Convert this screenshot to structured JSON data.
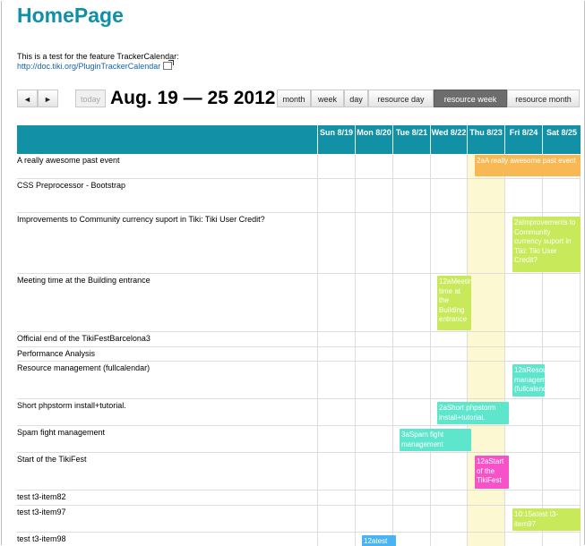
{
  "page": {
    "title": "HomePage",
    "description": "This is a test for the feature TrackerCalendar:",
    "link": "http://doc.tiki.org/PluginTrackerCalendar"
  },
  "toolbar": {
    "prev": "◄",
    "next": "►",
    "today": "today",
    "range": "Aug. 19 — 25 2012",
    "views": [
      "month",
      "week",
      "day",
      "resource day",
      "resource week",
      "resource month"
    ],
    "active_view": "resource week"
  },
  "days": [
    {
      "label": "Sun 8/19"
    },
    {
      "label": "Mon 8/20"
    },
    {
      "label": "Tue 8/21"
    },
    {
      "label": "Wed 8/22"
    },
    {
      "label": "Thu 8/23"
    },
    {
      "label": "Fri 8/24"
    },
    {
      "label": "Sat 8/25"
    }
  ],
  "resources": [
    "A really awesome past event",
    "CSS Preprocessor - Bootstrap",
    "Improvements to Community currency suport in Tiki: Tiki User Credit?",
    "Meeting time at the Building entrance",
    "Official end of the TikiFestBarcelona3",
    "Performance Analysis",
    "Resource management (fullcalendar)",
    "Short phpstorm install+tutorial.",
    "Spam fight management",
    "Start of the TikiFest",
    "test t3-item82",
    "test t3-item97",
    "test t3-item98"
  ],
  "events": [
    {
      "text": "2aA really awesome past event",
      "color": "#f8b955"
    },
    {
      "text": "2aImprovements to Community currency suport in Tiki: Tiki User Credit?",
      "color": "#c8ea5a"
    },
    {
      "text": "12aMeeting time at the Building entrance",
      "color": "#c8ea5a"
    },
    {
      "text": "12aResource management (fullcalendar)",
      "color": "#5ee6cc"
    },
    {
      "text": "2aShort phpstorm install+tutorial.",
      "color": "#5ee6cc"
    },
    {
      "text": "3aSpam fight management",
      "color": "#5ee6cc"
    },
    {
      "text": "12aStart of the TikiFest",
      "color": "#f553c7"
    },
    {
      "text": "10:15atest t3-item97",
      "color": "#c8ea5a"
    },
    {
      "text": "12atest",
      "color": "#4ab3f2"
    }
  ],
  "colors": {
    "header": "#1290a6",
    "title": "#0f90a8",
    "today_column": "#fcf8d2",
    "active_button": "#6d6d6d"
  }
}
